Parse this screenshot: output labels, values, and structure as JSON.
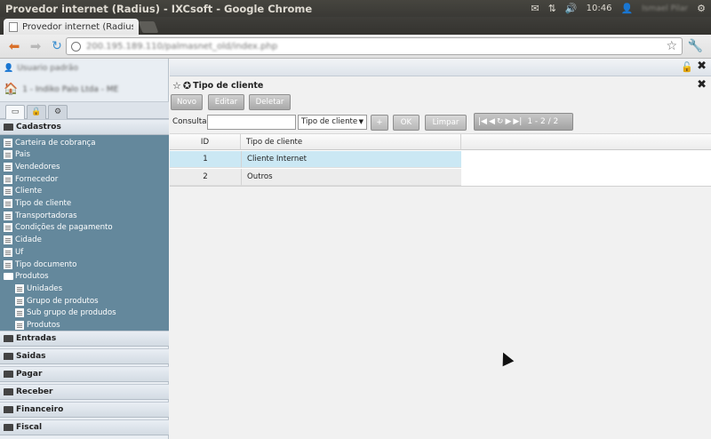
{
  "topbar": {
    "window_title": "Provedor internet (Radius) - IXCsoft - Google Chrome",
    "time": "10:46",
    "user": "Ismael Pilar"
  },
  "browser": {
    "tab_title": "Provedor internet (Radius ×",
    "url": "200.195.189.110/palmasnet_old/index.php"
  },
  "left": {
    "user": "Usuario padrão",
    "company": "1 - Indiko Palo Ltda - ME",
    "tabs": [
      "▭",
      "🔒",
      "⚙"
    ],
    "section_open": "Cadastros",
    "tree": [
      {
        "label": "Carteira de cobrança",
        "level": 0
      },
      {
        "label": "Pais",
        "level": 0
      },
      {
        "label": "Vendedores",
        "level": 0
      },
      {
        "label": "Fornecedor",
        "level": 0
      },
      {
        "label": "Cliente",
        "level": 0
      },
      {
        "label": "Tipo de cliente",
        "level": 0
      },
      {
        "label": "Transportadoras",
        "level": 0
      },
      {
        "label": "Condições de pagamento",
        "level": 0
      },
      {
        "label": "Cidade",
        "level": 0
      },
      {
        "label": "Uf",
        "level": 0
      },
      {
        "label": "Tipo documento",
        "level": 0
      },
      {
        "label": "Produtos",
        "level": 0,
        "folder": true
      },
      {
        "label": "Unidades",
        "level": 1
      },
      {
        "label": "Grupo de produtos",
        "level": 1
      },
      {
        "label": "Sub grupo de produdos",
        "level": 1
      },
      {
        "label": "Produtos",
        "level": 1
      }
    ],
    "sections": [
      "Entradas",
      "Saidas",
      "Pagar",
      "Receber",
      "Financeiro",
      "Fiscal"
    ]
  },
  "main": {
    "window_title": "Tipo de cliente",
    "buttons": {
      "novo": "Novo",
      "editar": "Editar",
      "deletar": "Deletar"
    },
    "search": {
      "label": "Consultar",
      "value": "",
      "field": "Tipo de cliente",
      "plus": "+",
      "ok": "OK",
      "limpar": "Limpar"
    },
    "pager": {
      "info": "1 - 2 / 2"
    },
    "grid": {
      "columns": [
        "ID",
        "Tipo de cliente"
      ],
      "rows": [
        {
          "id": "1",
          "tipo": "Cliente Internet"
        },
        {
          "id": "2",
          "tipo": "Outros"
        }
      ]
    }
  }
}
